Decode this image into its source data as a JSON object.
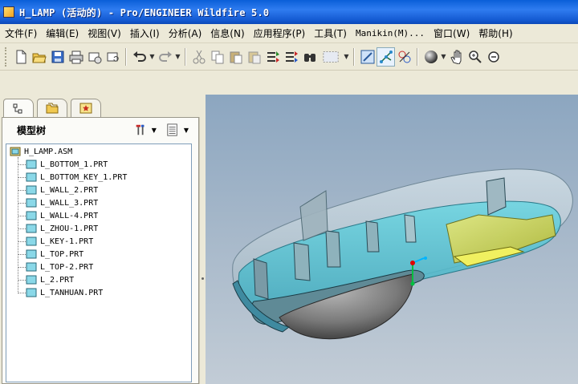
{
  "window": {
    "title": "H_LAMP (活动的) - Pro/ENGINEER Wildfire 5.0"
  },
  "menu": [
    {
      "label": "文件(F)",
      "name": "menu-file"
    },
    {
      "label": "编辑(E)",
      "name": "menu-edit"
    },
    {
      "label": "视图(V)",
      "name": "menu-view"
    },
    {
      "label": "插入(I)",
      "name": "menu-insert"
    },
    {
      "label": "分析(A)",
      "name": "menu-analysis"
    },
    {
      "label": "信息(N)",
      "name": "menu-info"
    },
    {
      "label": "应用程序(P)",
      "name": "menu-applications"
    },
    {
      "label": "工具(T)",
      "name": "menu-tools"
    },
    {
      "label": "Manikin(M)...",
      "name": "menu-manikin"
    },
    {
      "label": "窗口(W)",
      "name": "menu-window"
    },
    {
      "label": "帮助(H)",
      "name": "menu-help"
    }
  ],
  "toolbar": {
    "icons": [
      "new-file-icon",
      "open-folder-icon",
      "save-icon",
      "print-icon",
      "send-email-icon",
      "email-attachment-icon",
      "undo-icon",
      "redo-icon",
      "cut-icon",
      "copy-icon",
      "paste-icon",
      "paste-special-icon",
      "regenerate-icon",
      "regeneration-manager-icon",
      "find-icon",
      "select-box-icon",
      "view-datums-icon",
      "spin-center-icon",
      "view-manager-icon",
      "shading-sphere-icon",
      "pan-hand-icon",
      "zoom-in-icon",
      "zoom-out-icon"
    ]
  },
  "navigator": {
    "tabs": [
      "model-tree-tab",
      "folder-browser-tab",
      "favorites-tab"
    ],
    "title": "模型树",
    "tree": {
      "root": "H_LAMP.ASM",
      "children": [
        "L_BOTTOM_1.PRT",
        "L_BOTTOM_KEY_1.PRT",
        "L_WALL_2.PRT",
        "L_WALL_3.PRT",
        "L_WALL-4.PRT",
        "L_ZHOU-1.PRT",
        "L_KEY-1.PRT",
        "L_TOP.PRT",
        "L_TOP-2.PRT",
        "L_2.PRT",
        "L_TANHUAN.PRT"
      ]
    }
  },
  "colors": {
    "titlebar": "#2f7cf0",
    "viewport_bg": "#a5b7c9",
    "model_cyan": "#5fd0dc",
    "model_gray": "#8c8c8c",
    "key_yellow": "#d8d84c"
  }
}
